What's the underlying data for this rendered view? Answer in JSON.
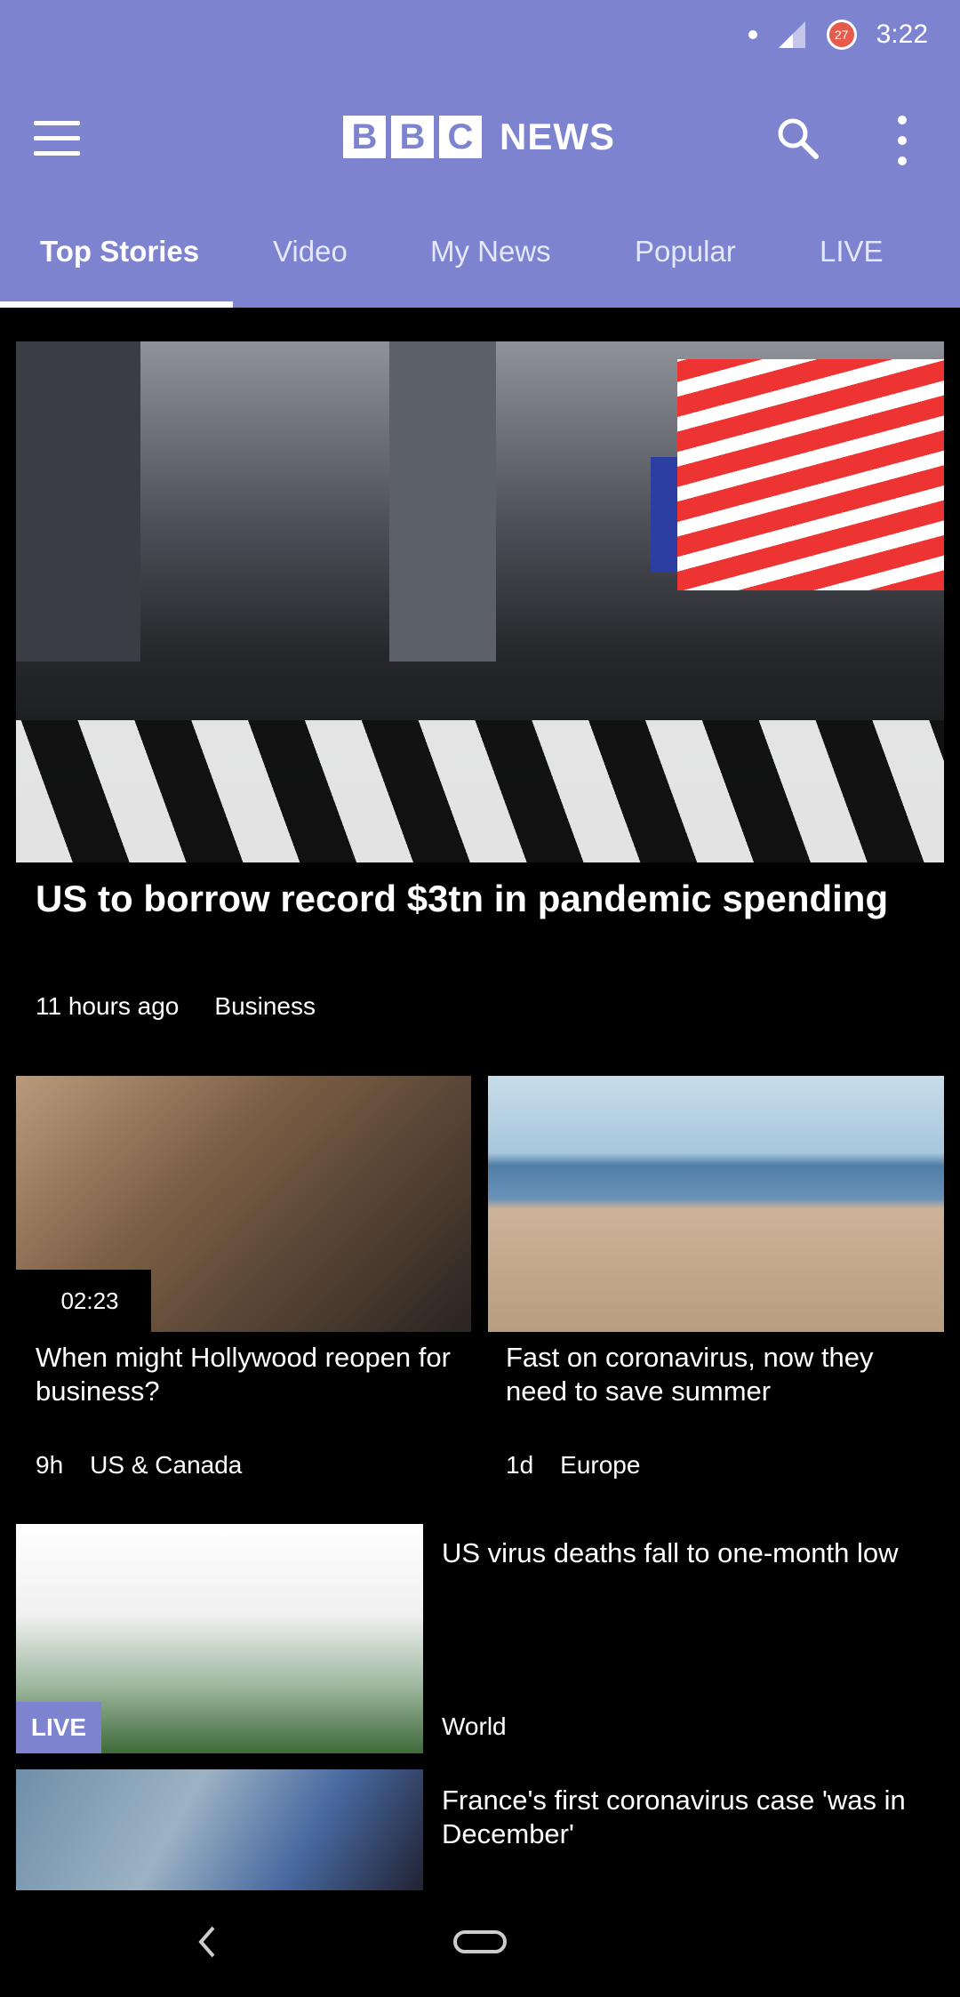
{
  "status_bar": {
    "time": "3:22",
    "battery_level": "27"
  },
  "app_bar": {
    "logo_letters": [
      "B",
      "B",
      "C"
    ],
    "logo_text": "NEWS"
  },
  "tabs": [
    {
      "label": "Top Stories",
      "active": true
    },
    {
      "label": "Video",
      "active": false
    },
    {
      "label": "My News",
      "active": false
    },
    {
      "label": "Popular",
      "active": false
    },
    {
      "label": "LIVE",
      "active": false
    }
  ],
  "stories": {
    "hero": {
      "title": "US to borrow record $3tn in pandemic spending",
      "time": "11 hours ago",
      "section": "Business"
    },
    "card_a": {
      "title": "When might Hollywood reopen for business?",
      "time": "9h",
      "section": "US & Canada",
      "duration": "02:23"
    },
    "card_b": {
      "title": "Fast on coronavirus, now they need to save summer",
      "time": "1d",
      "section": "Europe"
    },
    "row_c": {
      "title": "US virus deaths fall to one-month low",
      "section": "World",
      "badge": "LIVE"
    },
    "row_d": {
      "title": "France's first coronavirus case 'was in December'"
    }
  },
  "colors": {
    "brand": "#7d83cf",
    "background": "#000000"
  }
}
